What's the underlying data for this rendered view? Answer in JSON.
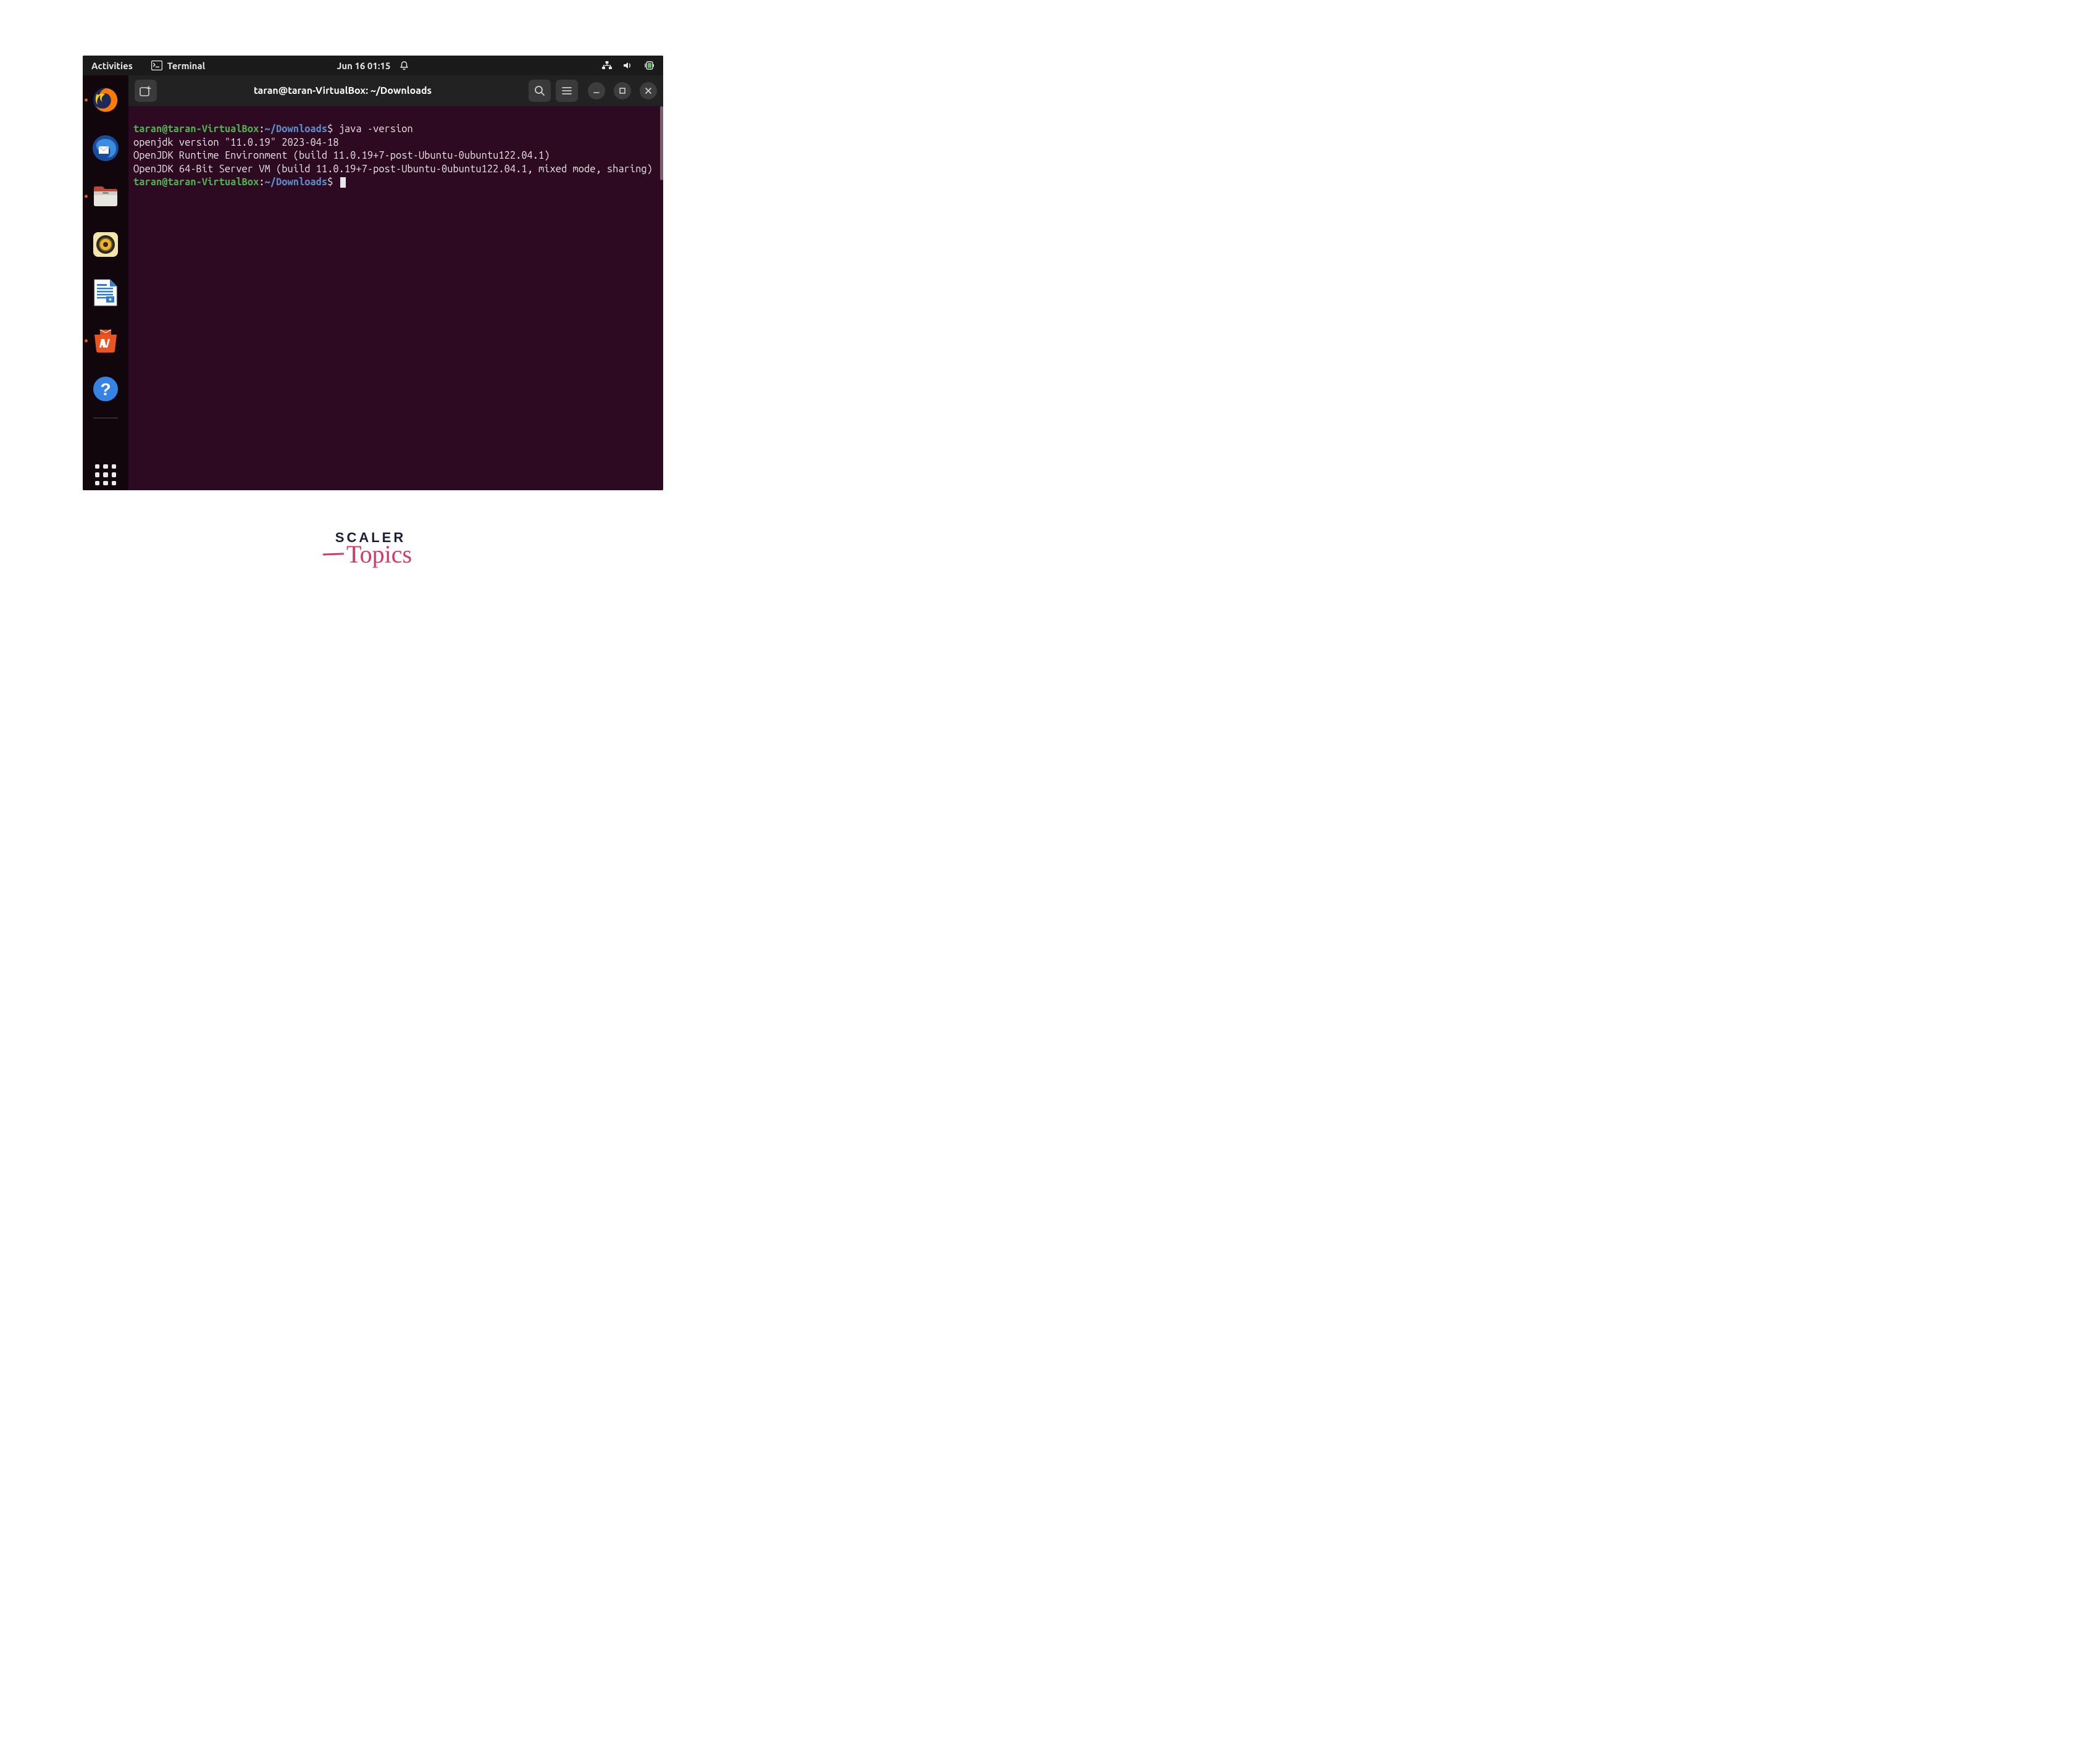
{
  "menubar": {
    "activities": "Activities",
    "app_label": "Terminal",
    "datetime": "Jun 16  01:15"
  },
  "titlebar": {
    "title": "taran@taran-VirtualBox: ~/Downloads"
  },
  "prompt": {
    "user_host": "taran@taran-VirtualBox",
    "separator": ":",
    "path": "~/Downloads",
    "symbol": "$"
  },
  "terminal": {
    "command": "java -version",
    "output_lines": [
      "openjdk version \"11.0.19\" 2023-04-18",
      "OpenJDK Runtime Environment (build 11.0.19+7-post-Ubuntu-0ubuntu122.04.1)",
      "OpenJDK 64-Bit Server VM (build 11.0.19+7-post-Ubuntu-0ubuntu122.04.1, mixed mode, sharing)"
    ]
  },
  "dock": {
    "items": [
      {
        "name": "firefox",
        "running": true
      },
      {
        "name": "thunderbird",
        "running": false
      },
      {
        "name": "files",
        "running": true
      },
      {
        "name": "rhythmbox",
        "running": false
      },
      {
        "name": "libreoffice-writer",
        "running": false
      },
      {
        "name": "ubuntu-software",
        "running": true
      },
      {
        "name": "help",
        "running": false
      }
    ]
  },
  "watermark": {
    "line1": "SCALER",
    "line2": "Topics"
  }
}
